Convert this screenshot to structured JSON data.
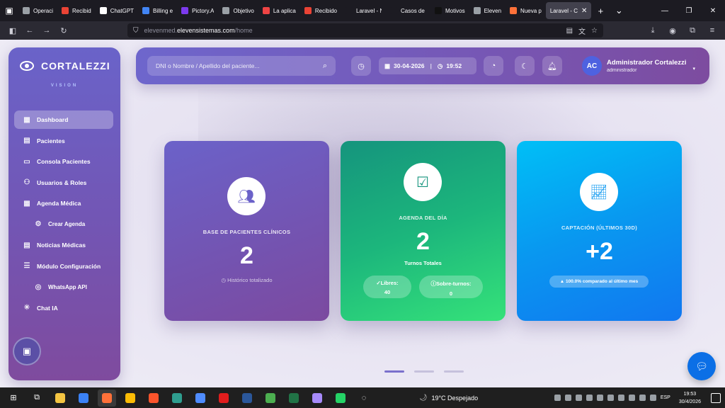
{
  "browser": {
    "tabs": [
      {
        "label": "Operaci",
        "color": "#9aa0a6"
      },
      {
        "label": "Recibid",
        "color": "#ea4335"
      },
      {
        "label": "ChatGPT",
        "color": "#ffffff"
      },
      {
        "label": "Billing e",
        "color": "#4285f4"
      },
      {
        "label": "Pictory.A",
        "color": "#7c3aed"
      },
      {
        "label": "Objetivo",
        "color": "#9aa0a6"
      },
      {
        "label": "La aplica",
        "color": "#ef4444"
      },
      {
        "label": "Recibido",
        "color": "#ea4335"
      },
      {
        "label": "Laravel - No",
        "color": "#1c1b22"
      },
      {
        "label": "Casos de Éxi",
        "color": "#1c1b22"
      },
      {
        "label": "Motivos",
        "color": "#111111"
      },
      {
        "label": "Eleven",
        "color": "#9aa0a6"
      },
      {
        "label": "Nueva p",
        "color": "#ff7139"
      }
    ],
    "active_tab": {
      "label": "Laravel - C"
    },
    "url_host": "elevenmed.",
    "url_domain": "elevensistemas.com",
    "url_path": "/home"
  },
  "sidebar": {
    "brand_name": "CORTALEZZI",
    "brand_sub": "VISION",
    "items": [
      {
        "label": "Dashboard",
        "icon": "grid-icon",
        "glyph": "▦"
      },
      {
        "label": "Pacientes",
        "icon": "id-card-icon",
        "glyph": "▤"
      },
      {
        "label": "Consola Pacientes",
        "icon": "monitor-icon",
        "glyph": "▭"
      },
      {
        "label": "Usuarios & Roles",
        "icon": "users-icon",
        "glyph": "⚇"
      },
      {
        "label": "Agenda Médica",
        "icon": "calendar-icon",
        "glyph": "▦"
      },
      {
        "label": "Crear Agenda",
        "icon": "gear-icon",
        "glyph": "⚙"
      },
      {
        "label": "Noticias Médicas",
        "icon": "newspaper-icon",
        "glyph": "▤"
      },
      {
        "label": "Módulo Configuración",
        "icon": "sliders-icon",
        "glyph": "☰"
      },
      {
        "label": "WhatsApp API",
        "icon": "whatsapp-icon",
        "glyph": "◎"
      },
      {
        "label": "Chat IA",
        "icon": "asterisk-icon",
        "glyph": "✳"
      }
    ]
  },
  "topbar": {
    "search_placeholder": "DNI o Nombre / Apellido del paciente...",
    "date": "30-04-2026",
    "time": "19:52",
    "user_initials": "AC",
    "user_name": "Administrador Cortalezzi",
    "user_role": "administrador"
  },
  "cards": {
    "patients": {
      "label": "BASE DE PACIENTES CLÍNICOS",
      "value": "2",
      "note": "Histórico totalizado"
    },
    "agenda": {
      "label": "AGENDA DEL DÍA",
      "value": "2",
      "sub": "Turnos Totales",
      "free_label": "Libres:",
      "free_value": "40",
      "over_label": "Sobre-turnos:",
      "over_value": "0"
    },
    "capture": {
      "label": "CAPTACIÓN (ÚLTIMOS 30D)",
      "value": "+2",
      "trend": "▲ 100.0% comparado al último mes"
    }
  },
  "taskbar": {
    "weather": "19°C  Despejado",
    "lang": "ESP",
    "time": "19:53",
    "date": "30/4/2026"
  },
  "colors": {
    "accent": "#6e66cc",
    "card_green": "#1cb67c",
    "card_blue": "#0997f0"
  }
}
